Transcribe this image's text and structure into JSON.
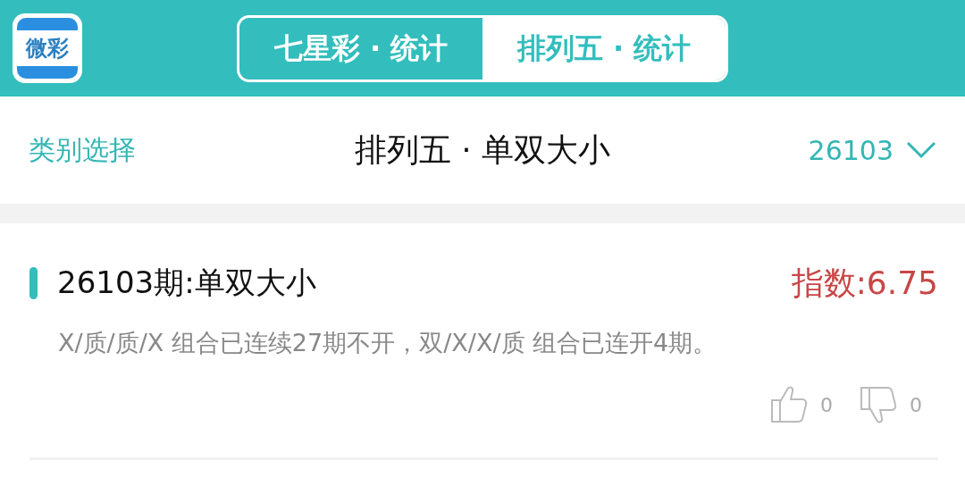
{
  "app_logo": {
    "text": "微彩"
  },
  "tabs": [
    {
      "label": "七星彩 · 统计",
      "selected": false
    },
    {
      "label": "排列五 · 统计",
      "selected": true
    }
  ],
  "subheader": {
    "category_link": "类别选择",
    "title": "排列五 · 单双大小",
    "issue": "26103"
  },
  "card": {
    "title": "26103期:单双大小",
    "index": "指数:6.75",
    "description": "X/质/质/X 组合已连续27期不开，双/X/X/质 组合已连开4期。",
    "likes": "0",
    "dislikes": "0"
  }
}
